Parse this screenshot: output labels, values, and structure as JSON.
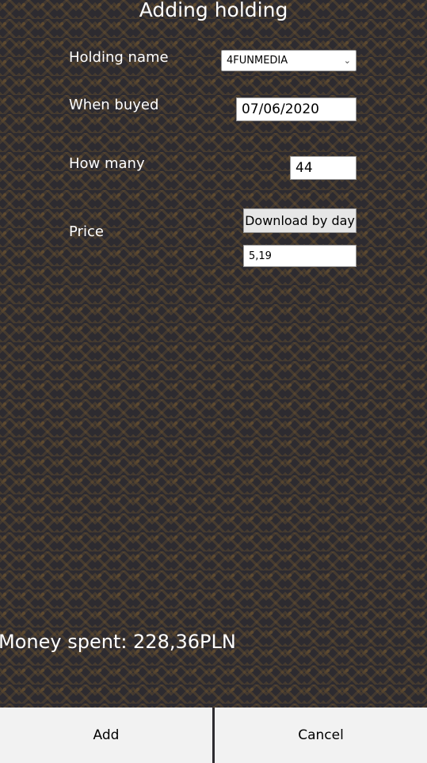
{
  "title": "Adding holding",
  "form": {
    "holding_name_label": "Holding name",
    "holding_name_value": "4FUNMEDIA",
    "when_buyed_label": "When buyed",
    "when_buyed_value": "07/06/2020",
    "how_many_label": "How many",
    "how_many_value": "44",
    "price_label": "Price",
    "download_button_label": "Download by day",
    "price_value": "5,19"
  },
  "summary": {
    "money_spent": "Money spent: 228,36PLN"
  },
  "actions": {
    "add_label": "Add",
    "cancel_label": "Cancel"
  },
  "icons": {
    "dropdown": "chevron-down-icon"
  }
}
